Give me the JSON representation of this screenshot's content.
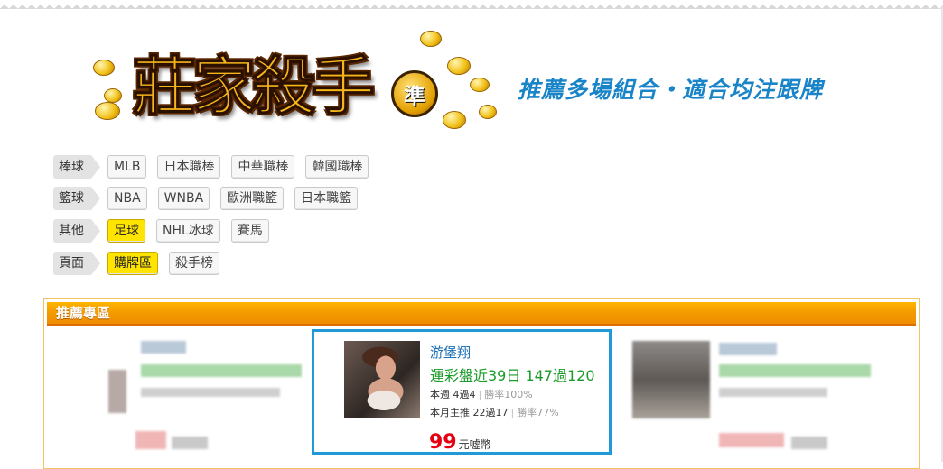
{
  "brand": {
    "logo_title": "莊家殺手",
    "logo_badge": "準",
    "tagline": "推薦多場組合・適合均注跟牌"
  },
  "categories": [
    {
      "label": "棒球",
      "items": [
        {
          "text": "MLB",
          "active": false
        },
        {
          "text": "日本職棒",
          "active": false
        },
        {
          "text": "中華職棒",
          "active": false
        },
        {
          "text": "韓國職棒",
          "active": false
        }
      ]
    },
    {
      "label": "籃球",
      "items": [
        {
          "text": "NBA",
          "active": false
        },
        {
          "text": "WNBA",
          "active": false
        },
        {
          "text": "歐洲職籃",
          "active": false
        },
        {
          "text": "日本職籃",
          "active": false
        }
      ]
    },
    {
      "label": "其他",
      "items": [
        {
          "text": "足球",
          "active": true
        },
        {
          "text": "NHL冰球",
          "active": false
        },
        {
          "text": "賽馬",
          "active": false
        }
      ]
    },
    {
      "label": "頁面",
      "items": [
        {
          "text": "購牌區",
          "active": true
        },
        {
          "text": "殺手榜",
          "active": false
        }
      ]
    }
  ],
  "panel": {
    "title": "推薦專區"
  },
  "featured": {
    "name": "游堡翔",
    "record": "運彩盤近39日 147過120",
    "week": "本週 4過4",
    "week_rate": "勝率100%",
    "month": "本月主推 22過17",
    "month_rate": "勝率77%",
    "price": "99",
    "price_unit": "元噓幣"
  },
  "colors": {
    "accent_blue": "#1f9ad6",
    "orange_header": "#f39a00",
    "active_chip": "#ffe400",
    "price_red": "#e60012",
    "record_green": "#1b9b2a"
  }
}
